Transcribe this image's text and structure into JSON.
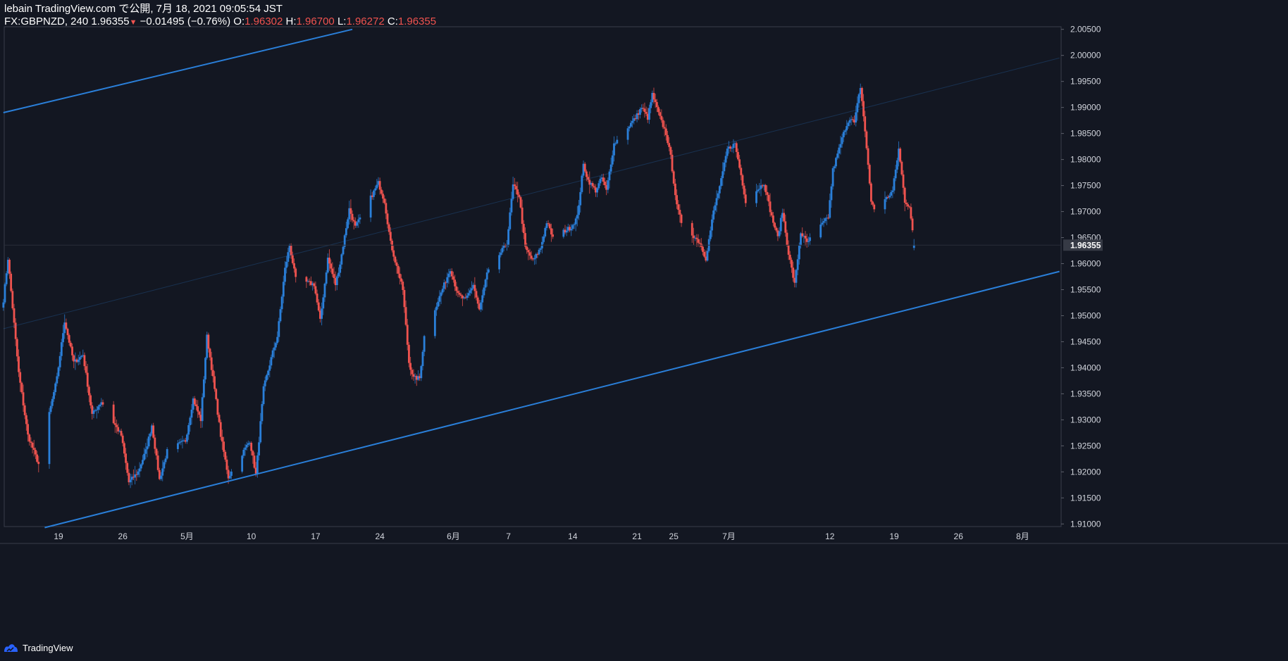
{
  "header": {
    "line1": "lebain TradingView.com で公開, 7月 18, 2021 09:05:54 JST",
    "symbol": "FX:GBPNZD, 240",
    "last": "1.96355",
    "arrow": "▼",
    "change": "−0.01495 (−0.76%)",
    "o_label": "O:",
    "o_value": "1.96302",
    "h_label": "H:",
    "h_value": "1.96700",
    "l_label": "L:",
    "l_value": "1.96272",
    "c_label": "C:",
    "c_value": "1.96355"
  },
  "footer": {
    "brand": "TradingView"
  },
  "colors": {
    "background": "#131722",
    "up": "#2a7fd9",
    "down": "#f0534f",
    "trendline": "#2a7fd9",
    "axis_text": "#d1d4dc"
  },
  "chart_data": {
    "type": "candlestick",
    "symbol": "FX:GBPNZD",
    "timeframe": "240",
    "ylim": [
      1.9095,
      2.0055
    ],
    "y_ticks": [
      "2.00500",
      "2.00000",
      "1.99500",
      "1.99000",
      "1.98500",
      "1.98000",
      "1.97500",
      "1.97000",
      "1.96500",
      "1.96000",
      "1.95500",
      "1.95000",
      "1.94500",
      "1.94000",
      "1.93500",
      "1.93000",
      "1.92500",
      "1.92000",
      "1.91500",
      "1.91000"
    ],
    "last_price_label": "1.96355",
    "x_ticks": [
      {
        "label": "19",
        "date": "2021-04-19"
      },
      {
        "label": "26",
        "date": "2021-04-26"
      },
      {
        "label": "5月",
        "date": "2021-05-03"
      },
      {
        "label": "10",
        "date": "2021-05-10"
      },
      {
        "label": "17",
        "date": "2021-05-17"
      },
      {
        "label": "24",
        "date": "2021-05-24"
      },
      {
        "label": "6月",
        "date": "2021-06-01"
      },
      {
        "label": "7",
        "date": "2021-06-07"
      },
      {
        "label": "14",
        "date": "2021-06-14"
      },
      {
        "label": "21",
        "date": "2021-06-21"
      },
      {
        "label": "25",
        "date": "2021-06-25"
      },
      {
        "label": "7月",
        "date": "2021-07-01"
      },
      {
        "label": "12",
        "date": "2021-07-12"
      },
      {
        "label": "19",
        "date": "2021-07-19"
      },
      {
        "label": "26",
        "date": "2021-07-26"
      },
      {
        "label": "8月",
        "date": "2021-08-02"
      }
    ],
    "path": [
      [
        "2021-04-13 00:00",
        1.953
      ],
      [
        "2021-04-13 12:00",
        1.961
      ],
      [
        "2021-04-14 16:00",
        1.939
      ],
      [
        "2021-04-15 16:00",
        1.927
      ],
      [
        "2021-04-16 20:00",
        1.9215
      ],
      [
        "2021-04-18 20:00",
        1.938
      ],
      [
        "2021-04-19 16:00",
        1.949
      ],
      [
        "2021-04-20 16:00",
        1.941
      ],
      [
        "2021-04-21 16:00",
        1.9425
      ],
      [
        "2021-04-22 16:00",
        1.931
      ],
      [
        "2021-04-23 16:00",
        1.9335
      ],
      [
        "2021-04-25 20:00",
        1.927
      ],
      [
        "2021-04-26 16:00",
        1.918
      ],
      [
        "2021-04-27 16:00",
        1.92
      ],
      [
        "2021-04-28 12:00",
        1.924
      ],
      [
        "2021-04-29 04:00",
        1.929
      ],
      [
        "2021-04-30 00:00",
        1.9185
      ],
      [
        "2021-04-30 20:00",
        1.924
      ],
      [
        "2021-05-02 20:00",
        1.926
      ],
      [
        "2021-05-03 16:00",
        1.934
      ],
      [
        "2021-05-04 12:00",
        1.93
      ],
      [
        "2021-05-05 04:00",
        1.946
      ],
      [
        "2021-05-05 20:00",
        1.938
      ],
      [
        "2021-05-06 16:00",
        1.927
      ],
      [
        "2021-05-07 12:00",
        1.919
      ],
      [
        "2021-05-09 20:00",
        1.926
      ],
      [
        "2021-05-10 12:00",
        1.9195
      ],
      [
        "2021-05-11 08:00",
        1.936
      ],
      [
        "2021-05-12 08:00",
        1.943
      ],
      [
        "2021-05-12 20:00",
        1.946
      ],
      [
        "2021-05-13 16:00",
        1.959
      ],
      [
        "2021-05-14 04:00",
        1.9635
      ],
      [
        "2021-05-14 20:00",
        1.957
      ],
      [
        "2021-05-16 20:00",
        1.956
      ],
      [
        "2021-05-17 12:00",
        1.949
      ],
      [
        "2021-05-18 08:00",
        1.961
      ],
      [
        "2021-05-19 04:00",
        1.956
      ],
      [
        "2021-05-19 16:00",
        1.96
      ],
      [
        "2021-05-20 16:00",
        1.9705
      ],
      [
        "2021-05-21 08:00",
        1.967
      ],
      [
        "2021-05-23 20:00",
        1.9755
      ],
      [
        "2021-05-24 12:00",
        1.972
      ],
      [
        "2021-05-25 04:00",
        1.964
      ],
      [
        "2021-05-25 16:00",
        1.9605
      ],
      [
        "2021-05-26 12:00",
        1.955
      ],
      [
        "2021-05-27 04:00",
        1.941
      ],
      [
        "2021-05-27 16:00",
        1.938
      ],
      [
        "2021-05-28 08:00",
        1.938
      ],
      [
        "2021-05-28 20:00",
        1.946
      ],
      [
        "2021-05-31 16:00",
        1.959
      ],
      [
        "2021-06-01 12:00",
        1.954
      ],
      [
        "2021-06-02 08:00",
        1.953
      ],
      [
        "2021-06-03 04:00",
        1.956
      ],
      [
        "2021-06-03 20:00",
        1.951
      ],
      [
        "2021-06-04 16:00",
        1.958
      ],
      [
        "2021-06-06 20:00",
        1.964
      ],
      [
        "2021-06-07 12:00",
        1.975
      ],
      [
        "2021-06-08 04:00",
        1.973
      ],
      [
        "2021-06-08 20:00",
        1.963
      ],
      [
        "2021-06-09 16:00",
        1.9605
      ],
      [
        "2021-06-10 12:00",
        1.963
      ],
      [
        "2021-06-11 04:00",
        1.968
      ],
      [
        "2021-06-11 20:00",
        1.965
      ],
      [
        "2021-06-13 20:00",
        1.967
      ],
      [
        "2021-06-14 12:00",
        1.969
      ],
      [
        "2021-06-15 04:00",
        1.979
      ],
      [
        "2021-06-15 16:00",
        1.976
      ],
      [
        "2021-06-16 12:00",
        1.974
      ],
      [
        "2021-06-17 04:00",
        1.9765
      ],
      [
        "2021-06-17 16:00",
        1.974
      ],
      [
        "2021-06-18 12:00",
        1.983
      ],
      [
        "2021-06-20 20:00",
        1.988
      ],
      [
        "2021-06-21 12:00",
        1.99
      ],
      [
        "2021-06-22 04:00",
        1.988
      ],
      [
        "2021-06-22 16:00",
        1.9925
      ],
      [
        "2021-06-23 12:00",
        1.988
      ],
      [
        "2021-06-24 04:00",
        1.985
      ],
      [
        "2021-06-24 16:00",
        1.9805
      ],
      [
        "2021-06-25 08:00",
        1.971
      ],
      [
        "2021-06-25 20:00",
        1.968
      ],
      [
        "2021-06-27 20:00",
        1.964
      ],
      [
        "2021-06-28 12:00",
        1.961
      ],
      [
        "2021-06-29 08:00",
        1.97
      ],
      [
        "2021-06-30 04:00",
        1.976
      ],
      [
        "2021-06-30 20:00",
        1.982
      ],
      [
        "2021-07-01 16:00",
        1.983
      ],
      [
        "2021-07-02 08:00",
        1.977
      ],
      [
        "2021-07-02 20:00",
        1.972
      ],
      [
        "2021-07-04 20:00",
        1.9755
      ],
      [
        "2021-07-05 16:00",
        1.969
      ],
      [
        "2021-07-06 08:00",
        1.965
      ],
      [
        "2021-07-06 20:00",
        1.97
      ],
      [
        "2021-07-07 12:00",
        1.962
      ],
      [
        "2021-07-08 04:00",
        1.956
      ],
      [
        "2021-07-08 20:00",
        1.966
      ],
      [
        "2021-07-09 12:00",
        1.964
      ],
      [
        "2021-07-11 20:00",
        1.969
      ],
      [
        "2021-07-12 08:00",
        1.978
      ],
      [
        "2021-07-12 20:00",
        1.981
      ],
      [
        "2021-07-13 16:00",
        1.986
      ],
      [
        "2021-07-14 04:00",
        1.988
      ],
      [
        "2021-07-14 16:00",
        1.987
      ],
      [
        "2021-07-15 08:00",
        1.994
      ],
      [
        "2021-07-15 20:00",
        1.9855
      ],
      [
        "2021-07-16 12:00",
        1.972
      ],
      [
        "2021-07-17 00:00",
        1.97
      ],
      [
        "2021-07-18 20:00",
        1.974
      ],
      [
        "2021-07-19 12:00",
        1.982
      ],
      [
        "2021-07-20 04:00",
        1.972
      ],
      [
        "2021-07-20 16:00",
        1.971
      ],
      [
        "2021-07-21 04:00",
        1.9636
      ]
    ],
    "trendlines": [
      {
        "from": [
          "2021-04-13 00:00",
          1.989
        ],
        "to": [
          "2021-05-21 00:00",
          2.005
        ]
      },
      {
        "from": [
          "2021-04-17 12:00",
          1.9093
        ],
        "to": [
          "2021-08-06 00:00",
          1.9585
        ]
      },
      {
        "from": [
          "2021-04-13 00:00",
          1.9475
        ],
        "to": [
          "2021-08-06 00:00",
          1.9995
        ]
      }
    ]
  }
}
